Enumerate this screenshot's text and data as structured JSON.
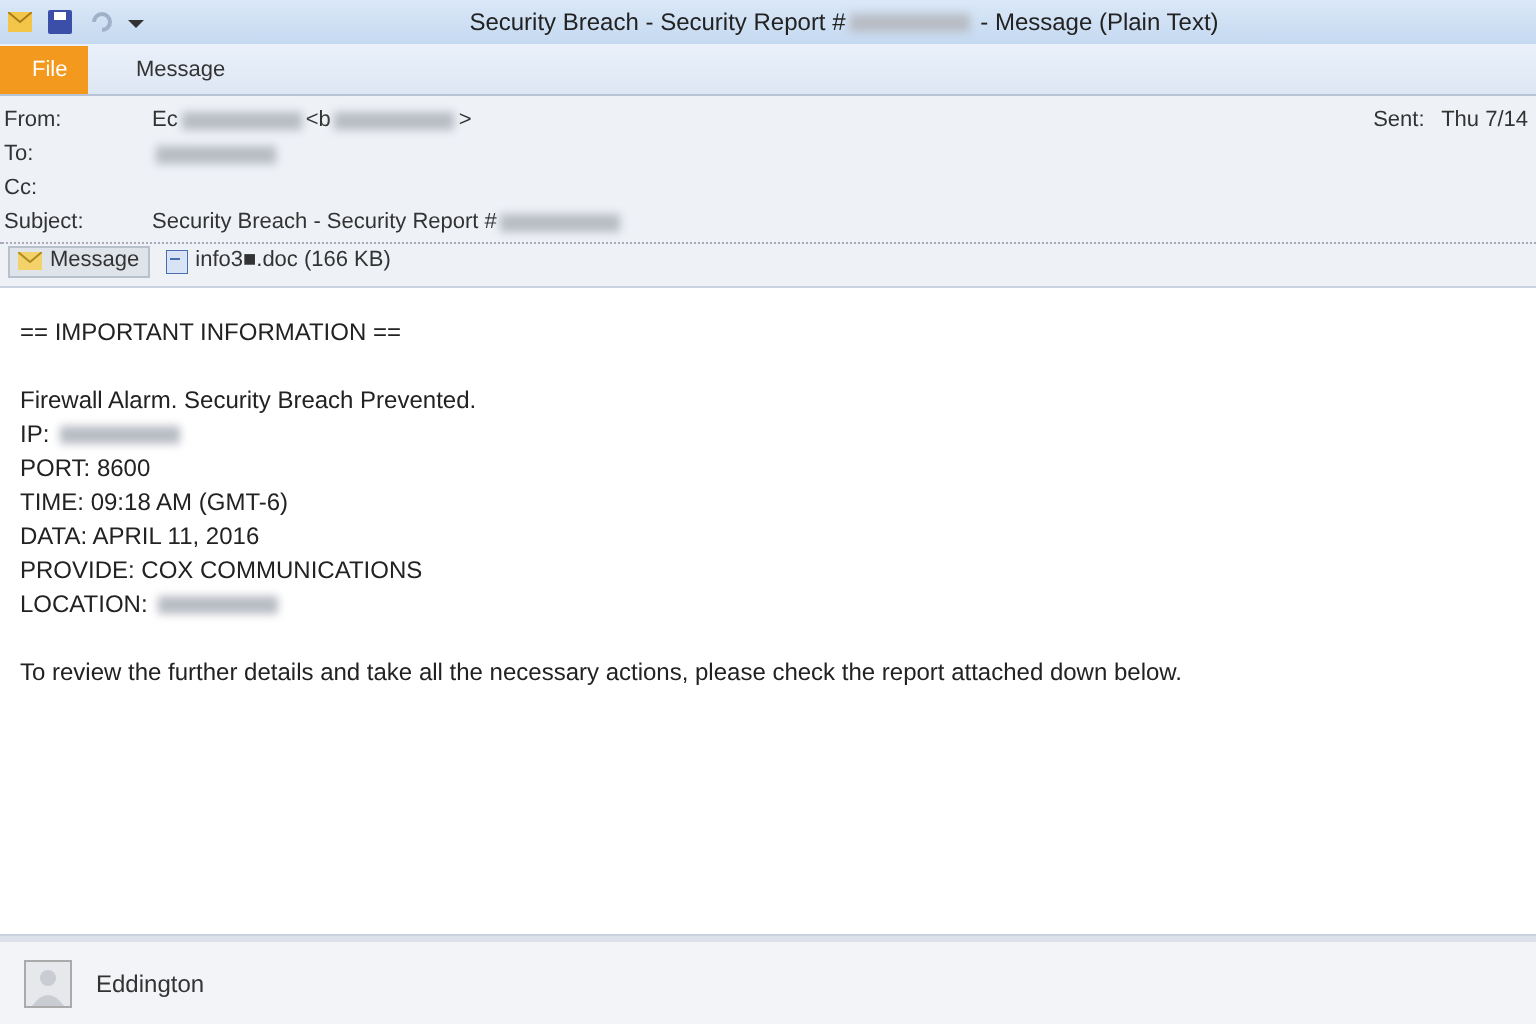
{
  "window": {
    "title": [
      {
        "kind": "text",
        "text": "Security Breach - Security Report #"
      },
      {
        "kind": "redacted"
      },
      {
        "kind": "text",
        "text": " - Message (Plain Text)"
      }
    ]
  },
  "ribbon_tabs": [
    {
      "label": "File",
      "selected": true
    },
    {
      "label": "Message",
      "selected": false
    }
  ],
  "header": {
    "fields": [
      {
        "label": "From:",
        "parts": [
          {
            "kind": "text",
            "text": "Ec"
          },
          {
            "kind": "redacted"
          },
          {
            "kind": "text",
            "text": "<b"
          },
          {
            "kind": "redacted"
          },
          {
            "kind": "text",
            "text": ">"
          }
        ]
      },
      {
        "label": "To:",
        "parts": [
          {
            "kind": "redacted"
          }
        ]
      },
      {
        "label": "Cc:"
      },
      {
        "label": "Subject:",
        "parts": [
          {
            "kind": "text",
            "text": "Security Breach - Security Report #"
          },
          {
            "kind": "redacted"
          }
        ]
      }
    ],
    "sent_label": "Sent:",
    "sent_value": "Thu 7/14"
  },
  "attachments": [
    {
      "label": "Message",
      "kind": "message",
      "selected": true
    },
    {
      "label": "info3■.doc (166 KB)",
      "kind": "doc",
      "selected": false
    }
  ],
  "body": [
    {
      "lines": [
        {
          "parts": [
            {
              "kind": "text",
              "text": "== IMPORTANT INFORMATION =="
            }
          ]
        }
      ]
    },
    {
      "lines": [
        {
          "parts": [
            {
              "kind": "text",
              "text": "Firewall Alarm. Security Breach Prevented."
            }
          ]
        },
        {
          "parts": [
            {
              "kind": "text",
              "text": "IP: "
            },
            {
              "kind": "redacted"
            }
          ]
        },
        {
          "parts": [
            {
              "kind": "text",
              "text": "PORT: 8600"
            }
          ]
        },
        {
          "parts": [
            {
              "kind": "text",
              "text": "TIME: 09:18 AM (GMT-6)"
            }
          ]
        },
        {
          "parts": [
            {
              "kind": "text",
              "text": "DATA: APRIL 11, 2016"
            }
          ]
        },
        {
          "parts": [
            {
              "kind": "text",
              "text": "PROVIDE: COX COMMUNICATIONS"
            }
          ]
        },
        {
          "parts": [
            {
              "kind": "text",
              "text": "LOCATION: "
            },
            {
              "kind": "redacted"
            }
          ]
        }
      ]
    },
    {
      "lines": [
        {
          "parts": [
            {
              "kind": "text",
              "text": "To review the further details and take all the necessary actions, please check the report attached down below."
            }
          ]
        }
      ]
    }
  ],
  "people_pane": {
    "name": "Eddington"
  }
}
